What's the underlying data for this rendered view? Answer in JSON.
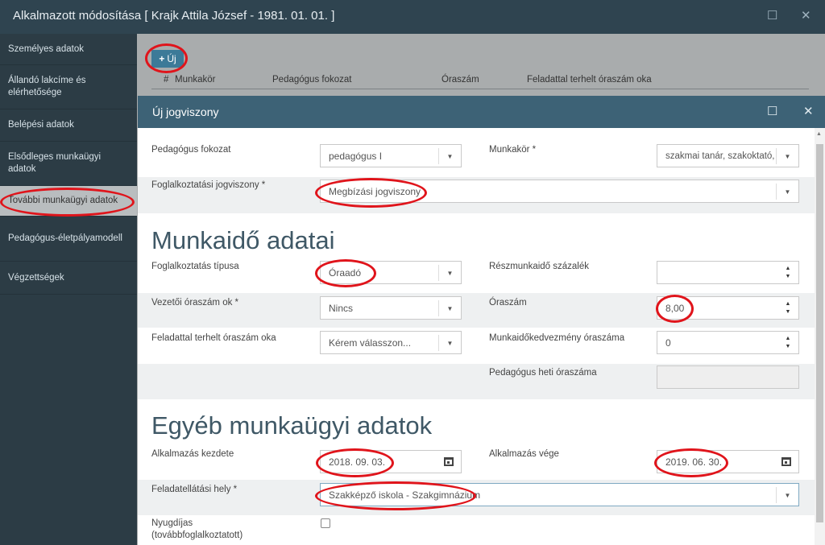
{
  "window": {
    "title": "Alkalmazott módosítása [ Krajk Attila József - 1981. 01. 01. ]"
  },
  "icons": {
    "maximize": "maximize-icon",
    "close": "close-icon",
    "plus": "plus-icon",
    "calendar": "calendar-icon",
    "caret": "caret-down-icon"
  },
  "sidebar": {
    "items": [
      {
        "label": "Személyes adatok"
      },
      {
        "label": "Állandó lakcíme és elérhetősége"
      },
      {
        "label": "Belépési adatok"
      },
      {
        "label": "Elsődleges munkaügyi adatok"
      },
      {
        "label": "További munkaügyi adatok"
      },
      {
        "label": "Pedagógus-életpályamodell"
      },
      {
        "label": "Végzettségek"
      }
    ]
  },
  "background": {
    "new_button": "Új",
    "columns": [
      "#",
      "Munkakör",
      "Pedagógus fokozat",
      "Óraszám",
      "Feladattal terhelt óraszám oka"
    ]
  },
  "modal": {
    "title": "Új jogviszony",
    "fields": {
      "pedagogus_fokozat": {
        "label": "Pedagógus fokozat",
        "value": "pedagógus I"
      },
      "munkakor": {
        "label": "Munkakör *",
        "value": "szakmai tanár, szakoktató, g"
      },
      "foglalkoztatasi_jogviszony": {
        "label": "Foglalkoztatási jogviszony *",
        "value": "Megbízási jogviszony"
      }
    },
    "section1": {
      "title": "Munkaidő adatai",
      "foglalkoztatas_tipusa": {
        "label": "Foglalkoztatás típusa",
        "value": "Óraadó"
      },
      "reszmunkaido": {
        "label": "Részmunkaidő százalék",
        "value": ""
      },
      "vezetoi_oraszam_ok": {
        "label": "Vezetői óraszám ok *",
        "value": "Nincs"
      },
      "oraszam": {
        "label": "Óraszám",
        "value": "8,00"
      },
      "feladattal_terhelt": {
        "label": "Feladattal terhelt óraszám oka",
        "value": "Kérem válasszon..."
      },
      "munkaido_kedvezmeny": {
        "label": "Munkaidőkedvezmény óraszáma",
        "value": "0"
      },
      "heti_oraszam": {
        "label": "Pedagógus heti óraszáma",
        "value": ""
      }
    },
    "section2": {
      "title": "Egyéb munkaügyi adatok",
      "alkalmazas_kezdete": {
        "label": "Alkalmazás kezdete",
        "value": "2018. 09. 03."
      },
      "alkalmazas_vege": {
        "label": "Alkalmazás vége",
        "value": "2019. 06. 30."
      },
      "feladatellatasi_hely": {
        "label": "Feladatellátási hely *",
        "value": "Szakképző iskola - Szakgimnázium"
      },
      "nyugdijas": {
        "label": "Nyugdíjas (továbbfoglalkoztatott)"
      }
    }
  }
}
